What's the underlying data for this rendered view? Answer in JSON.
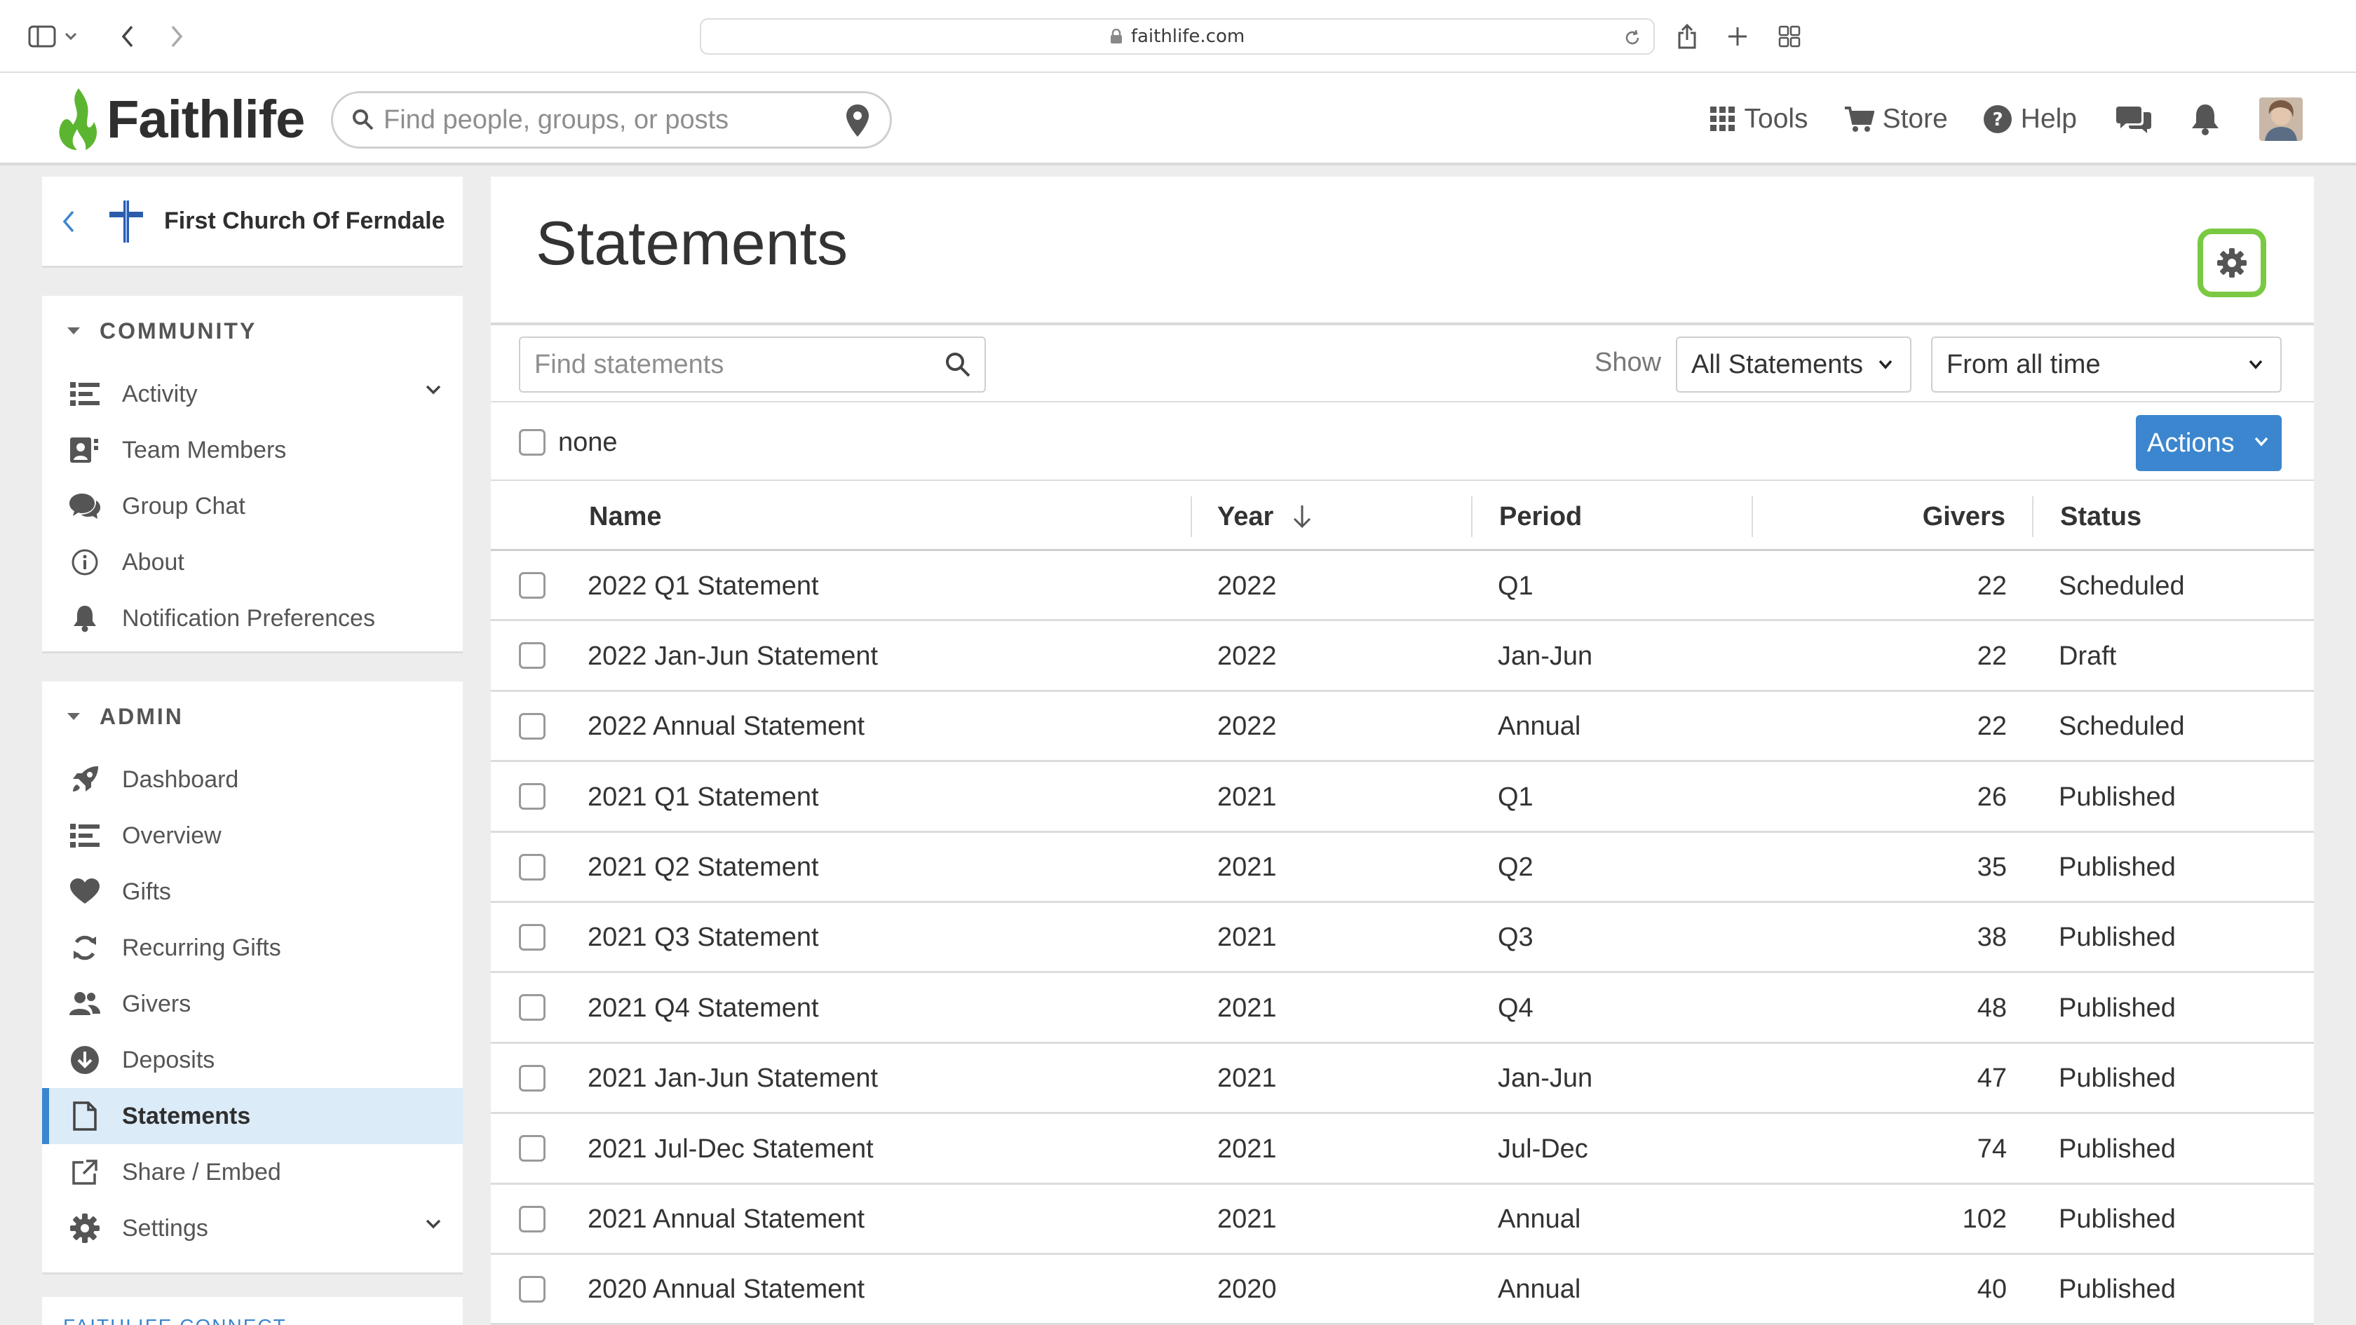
{
  "browser": {
    "url": "faithlife.com"
  },
  "topnav": {
    "logo_text": "Faithlife",
    "search_placeholder": "Find people, groups, or posts",
    "tools_label": "Tools",
    "store_label": "Store",
    "help_label": "Help"
  },
  "group": {
    "name": "First Church Of Ferndale"
  },
  "sidebar": {
    "community_header": "COMMUNITY",
    "community_items": [
      {
        "label": "Activity",
        "icon": "activity-list-icon"
      },
      {
        "label": "Team Members",
        "icon": "team-members-icon"
      },
      {
        "label": "Group Chat",
        "icon": "chat-bubbles-icon"
      },
      {
        "label": "About",
        "icon": "info-icon"
      },
      {
        "label": "Notification Preferences",
        "icon": "bell-icon"
      }
    ],
    "admin_header": "ADMIN",
    "admin_items": [
      {
        "label": "Dashboard",
        "icon": "rocket-icon"
      },
      {
        "label": "Overview",
        "icon": "overview-list-icon"
      },
      {
        "label": "Gifts",
        "icon": "heart-icon"
      },
      {
        "label": "Recurring Gifts",
        "icon": "recurring-icon"
      },
      {
        "label": "Givers",
        "icon": "people-icon"
      },
      {
        "label": "Deposits",
        "icon": "deposit-icon"
      },
      {
        "label": "Statements",
        "icon": "document-icon"
      },
      {
        "label": "Share / Embed",
        "icon": "share-icon"
      },
      {
        "label": "Settings",
        "icon": "gear-icon"
      }
    ],
    "connect_header": "FAITHLIFE CONNECT"
  },
  "main": {
    "title": "Statements",
    "find_placeholder": "Find statements",
    "show_label": "Show",
    "filter_type": "All Statements",
    "filter_time": "From all time",
    "select_none_label": "none",
    "actions_label": "Actions",
    "columns": {
      "name": "Name",
      "year": "Year",
      "period": "Period",
      "givers": "Givers",
      "status": "Status"
    },
    "rows": [
      {
        "name": "2022 Q1 Statement",
        "year": "2022",
        "period": "Q1",
        "givers": "22",
        "status": "Scheduled"
      },
      {
        "name": "2022 Jan-Jun Statement",
        "year": "2022",
        "period": "Jan-Jun",
        "givers": "22",
        "status": "Draft"
      },
      {
        "name": "2022 Annual Statement",
        "year": "2022",
        "period": "Annual",
        "givers": "22",
        "status": "Scheduled"
      },
      {
        "name": "2021 Q1 Statement",
        "year": "2021",
        "period": "Q1",
        "givers": "26",
        "status": "Published"
      },
      {
        "name": "2021 Q2 Statement",
        "year": "2021",
        "period": "Q2",
        "givers": "35",
        "status": "Published"
      },
      {
        "name": "2021 Q3 Statement",
        "year": "2021",
        "period": "Q3",
        "givers": "38",
        "status": "Published"
      },
      {
        "name": "2021 Q4 Statement",
        "year": "2021",
        "period": "Q4",
        "givers": "48",
        "status": "Published"
      },
      {
        "name": "2021 Jan-Jun Statement",
        "year": "2021",
        "period": "Jan-Jun",
        "givers": "47",
        "status": "Published"
      },
      {
        "name": "2021 Jul-Dec Statement",
        "year": "2021",
        "period": "Jul-Dec",
        "givers": "74",
        "status": "Published"
      },
      {
        "name": "2021 Annual Statement",
        "year": "2021",
        "period": "Annual",
        "givers": "102",
        "status": "Published"
      },
      {
        "name": "2020 Annual Statement",
        "year": "2020",
        "period": "Annual",
        "givers": "40",
        "status": "Published"
      }
    ]
  },
  "colors": {
    "accent_blue": "#3b86cf",
    "active_bg": "#dcebf8",
    "logo_green": "#5cb531",
    "settings_outline": "#7ac943"
  }
}
